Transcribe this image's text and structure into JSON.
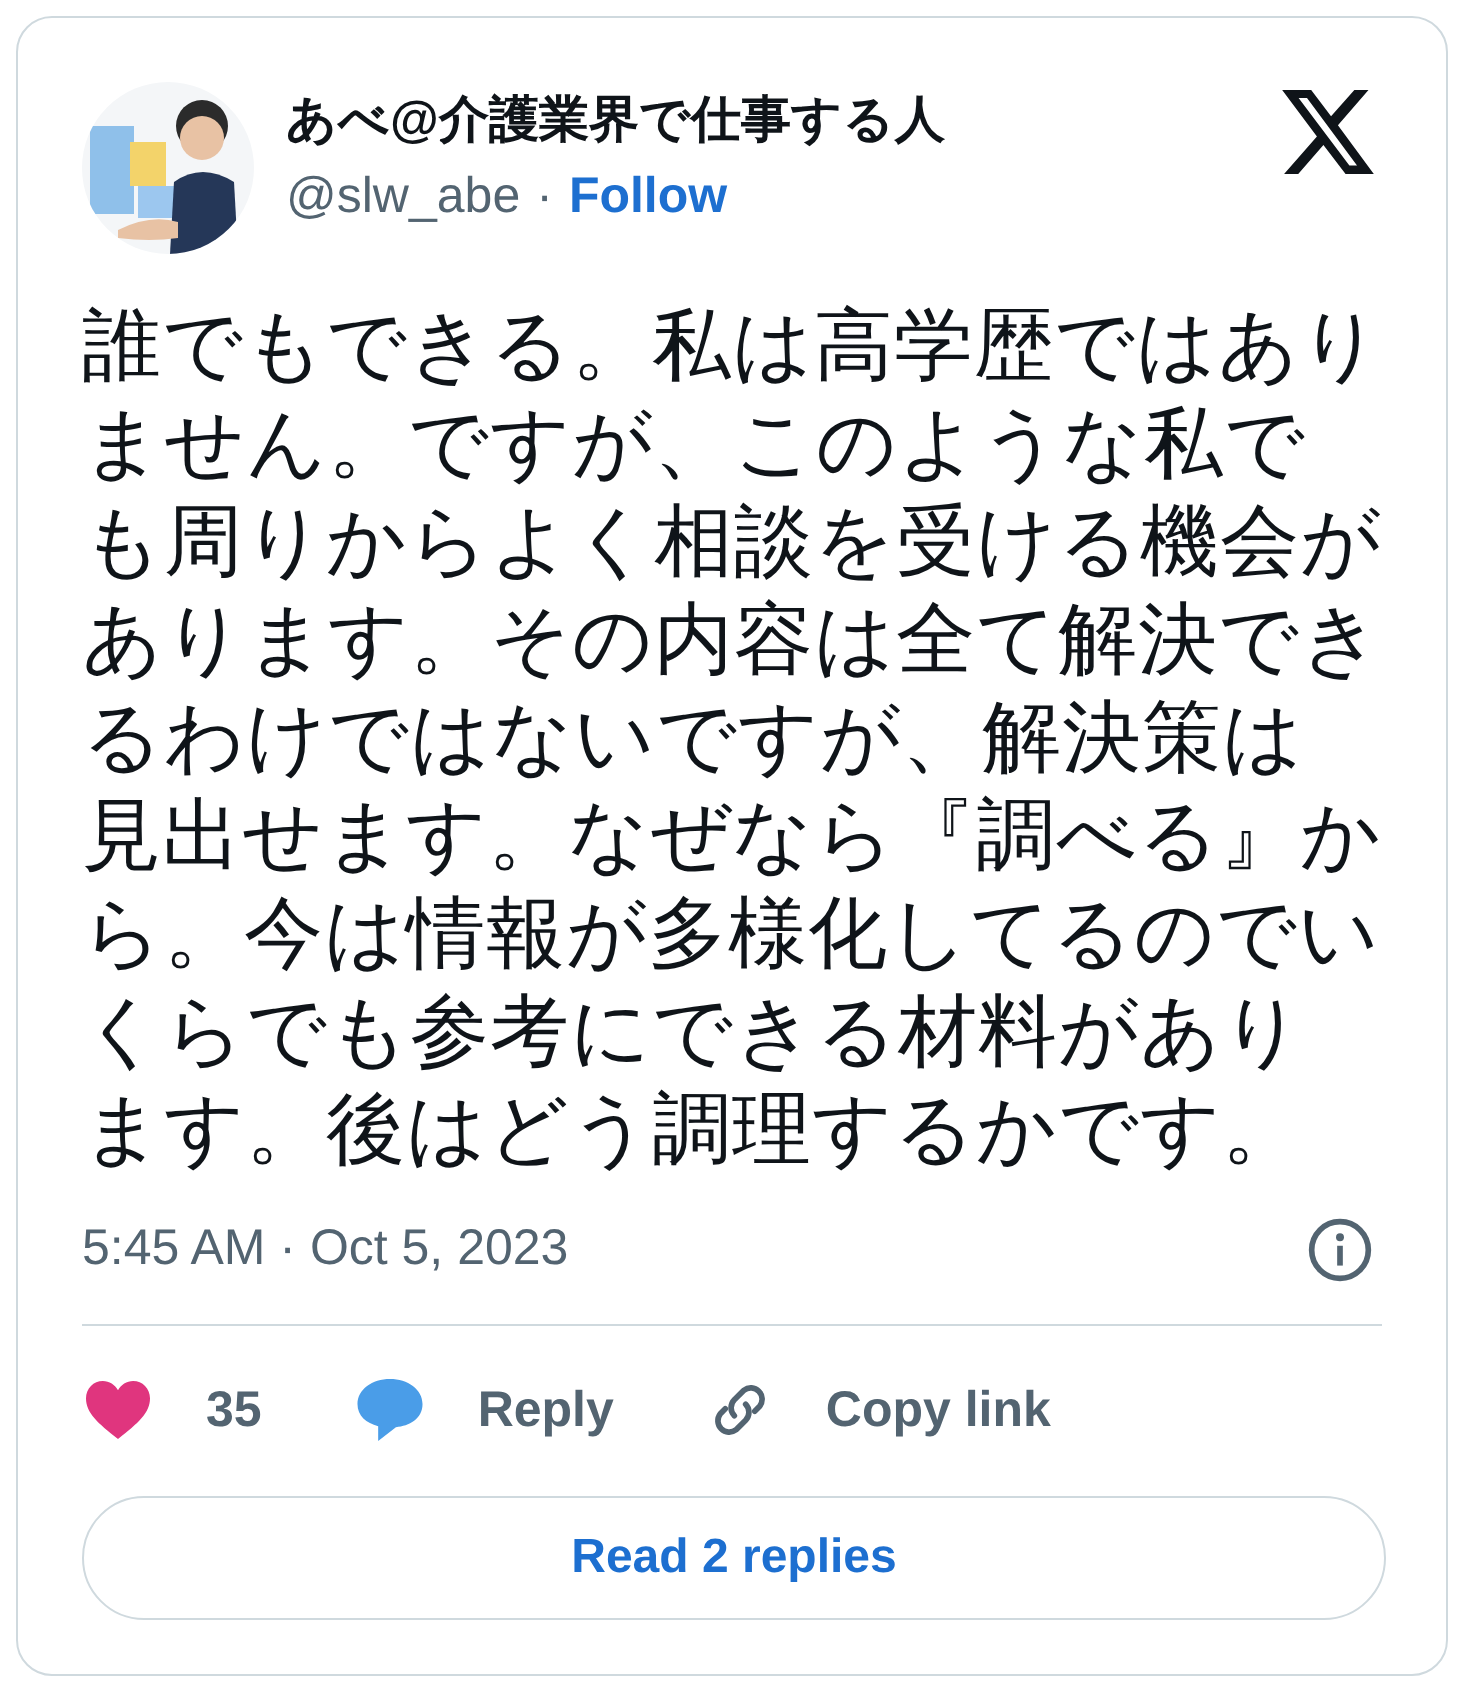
{
  "author": {
    "name": "あべ@介護業界で仕事する人",
    "handle": "@slw_abe",
    "separator": "·",
    "follow": "Follow"
  },
  "body": "誰でもできる。私は高学歴ではありません。ですが、このような私でも周りからよく相談を受ける機会があります。その内容は全て解決できるわけではないですが、解決策は見出せます。なぜなら『調べる』から。今は情報が多様化してるのでいくらでも参考にできる材料があります。後はどう調理するかです。",
  "timestamp": "5:45 AM · Oct 5, 2023",
  "actions": [
    {
      "kind": "like",
      "label": "35"
    },
    {
      "kind": "reply",
      "label": "Reply"
    },
    {
      "kind": "copy",
      "label": "Copy link"
    }
  ],
  "read_replies": "Read 2 replies"
}
